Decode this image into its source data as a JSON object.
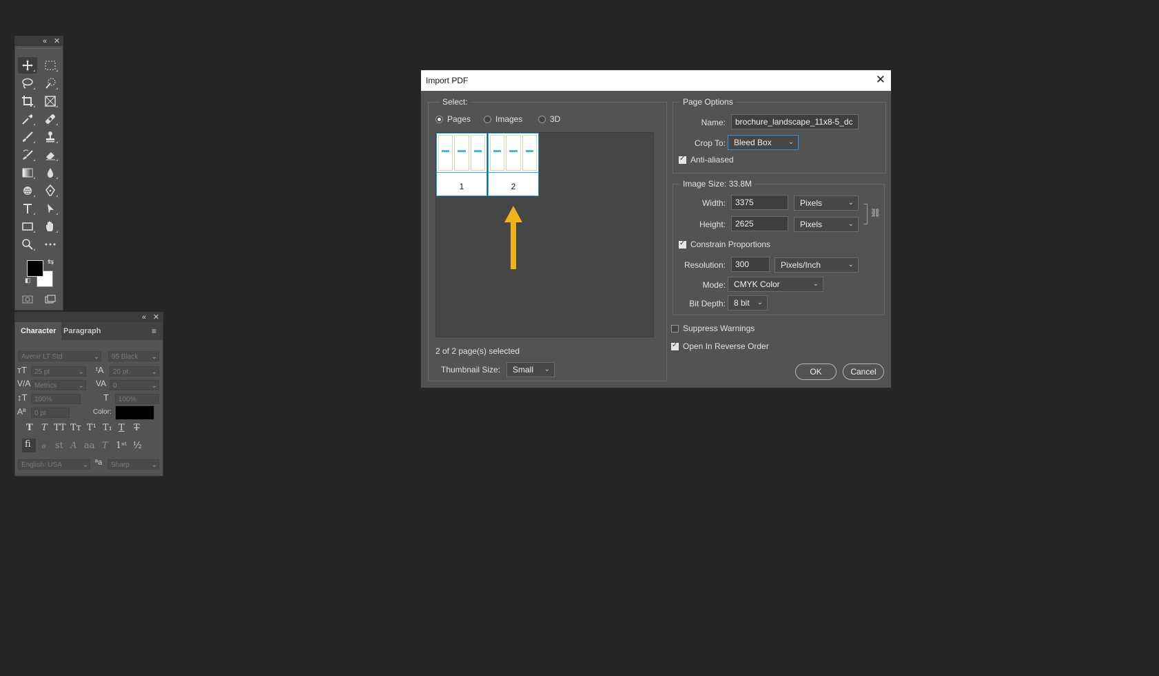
{
  "dialog": {
    "title": "Import PDF",
    "close_glyph": "✕",
    "select": {
      "legend": "Select:",
      "options": [
        "Pages",
        "Images",
        "3D"
      ],
      "selected": "Pages"
    },
    "thumbnails": [
      {
        "page_number": "1"
      },
      {
        "page_number": "2"
      }
    ],
    "status": "2 of 2 page(s) selected",
    "thumbnail_size_label": "Thumbnail Size:",
    "thumbnail_size_value": "Small",
    "page_options": {
      "legend": "Page Options",
      "name_label": "Name:",
      "name_value": "brochure_landscape_11x8-5_dc",
      "crop_label": "Crop To:",
      "crop_value": "Bleed Box",
      "anti_aliased_label": "Anti-aliased",
      "anti_aliased": true
    },
    "image_size": {
      "legend": "Image Size: 33.8M",
      "width_label": "Width:",
      "width_value": "3375",
      "width_unit": "Pixels",
      "height_label": "Height:",
      "height_value": "2625",
      "height_unit": "Pixels",
      "constrain_label": "Constrain Proportions",
      "constrain": true,
      "resolution_label": "Resolution:",
      "resolution_value": "300",
      "resolution_unit": "Pixels/Inch",
      "mode_label": "Mode:",
      "mode_value": "CMYK Color",
      "bit_depth_label": "Bit Depth:",
      "bit_depth_value": "8 bit"
    },
    "suppress_warnings_label": "Suppress Warnings",
    "suppress_warnings": false,
    "reverse_order_label": "Open In Reverse Order",
    "reverse_order": true,
    "ok_label": "OK",
    "cancel_label": "Cancel"
  },
  "annotation": {
    "arrow_color": "#f2b21b"
  },
  "character_panel": {
    "tabs": [
      "Character",
      "Paragraph"
    ],
    "font_family": "Avenir LT Std",
    "font_style": "95 Black",
    "font_size": "25 pt",
    "leading": "20 pt",
    "kerning": "Metrics",
    "tracking": "0",
    "vertical_scale": "100%",
    "horizontal_scale": "100%",
    "baseline_shift": "0 pt",
    "color_label": "Color:",
    "language": "English: USA",
    "antialias": "Sharp"
  },
  "colors": {
    "foreground": "#000000",
    "background": "#ffffff"
  }
}
